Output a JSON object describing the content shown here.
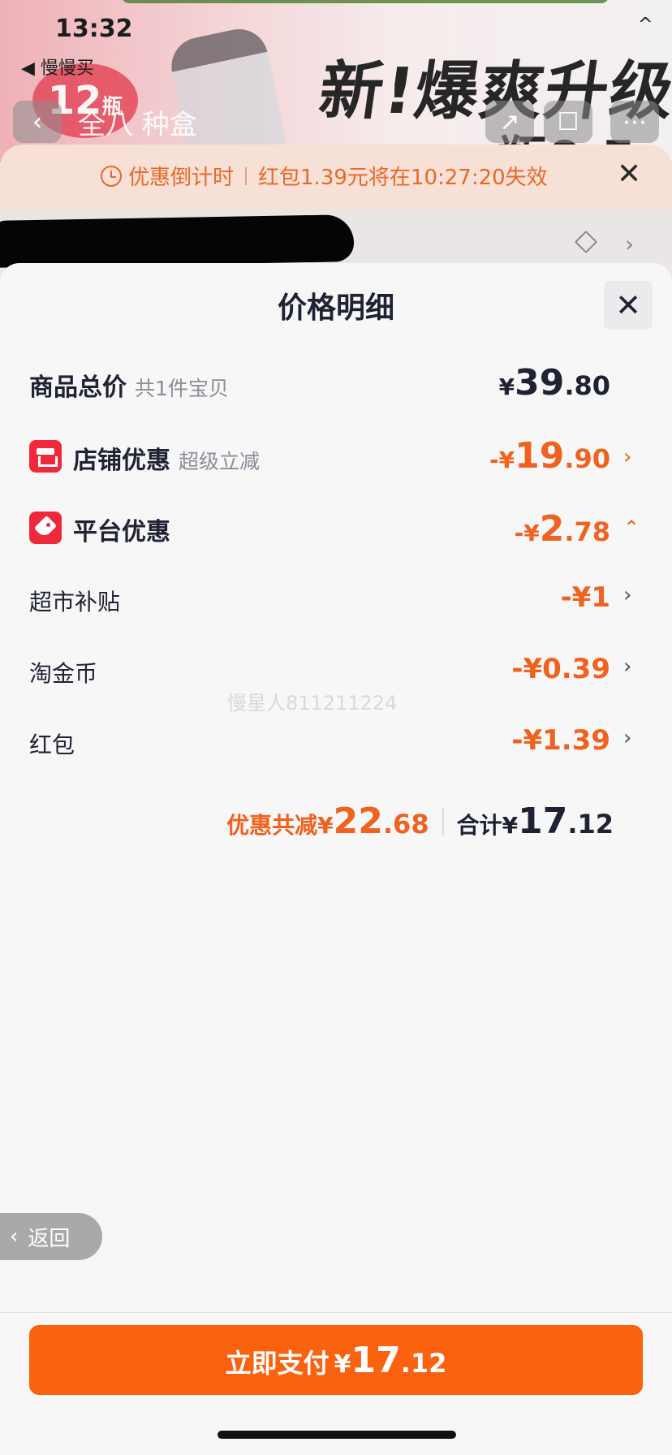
{
  "status_bar": {
    "time": "13:32",
    "back_app": "◀ 慢慢买",
    "caret": "^"
  },
  "banner": {
    "badge_number": "12",
    "badge_unit": "瓶",
    "headline": "新!爆爽升级",
    "subline": "——瓶0.5",
    "nav_sub": "全八 种盒"
  },
  "countdown": {
    "label": "优惠倒计时",
    "message": "红包1.39元将在10:27:20失效"
  },
  "sheet": {
    "title": "价格明细",
    "rows": [
      {
        "label": "商品总价",
        "sub": "共1件宝贝",
        "currency": "¥",
        "int": "39",
        "dec": ".80"
      },
      {
        "label": "店铺优惠",
        "sub": "超级立减",
        "currency": "-¥",
        "int": "19",
        "dec": ".90"
      },
      {
        "label": "平台优惠",
        "sub": "",
        "currency": "-¥",
        "int": "2",
        "dec": ".78"
      },
      {
        "label": "超市补贴",
        "amount": "-¥1"
      },
      {
        "label": "淘金币",
        "amount": "-¥0.39"
      },
      {
        "label": "红包",
        "amount": "-¥1.39"
      }
    ],
    "watermark": "慢星人811211224",
    "summary": {
      "discount_label": "优惠共减",
      "discount_currency": "¥",
      "discount_int": "22",
      "discount_dec": ".68",
      "total_label": "合计",
      "total_currency": "¥",
      "total_int": "17",
      "total_dec": ".12"
    }
  },
  "back_button": {
    "label": "返回"
  },
  "pay_button": {
    "label": "立即支付",
    "currency": "¥",
    "int": "17",
    "dec": ".12"
  },
  "colors": {
    "accent": "#fb6210",
    "discount": "#f0621f",
    "icon_red": "#f0283b"
  },
  "icons": [
    "clock-icon",
    "close-icon",
    "edit-icon",
    "chevron-right-icon",
    "shop-icon",
    "coupon-tag-icon",
    "chevron-up-icon",
    "chevron-left-icon"
  ]
}
